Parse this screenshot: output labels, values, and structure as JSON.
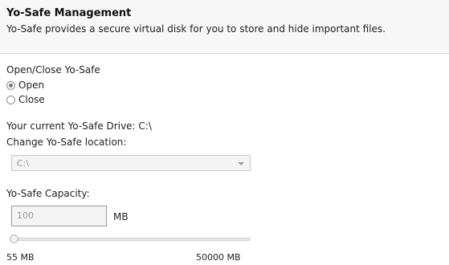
{
  "header": {
    "title": "Yo-Safe Management",
    "subtitle": "Yo-Safe provides a secure virtual disk for you to store and hide important files."
  },
  "toggle": {
    "label": "Open/Close Yo-Safe",
    "options": [
      "Open",
      "Close"
    ],
    "selected": "Open"
  },
  "drive": {
    "current_label": "Your current Yo-Safe Drive: C:\\",
    "change_label": "Change Yo-Safe location:",
    "selected_value": "C:\\"
  },
  "capacity": {
    "label": "Yo-Safe Capacity:",
    "value": "100",
    "unit": "MB",
    "min_label": "55 MB",
    "max_label": "50000 MB",
    "slider_fraction": 0.0
  },
  "colors": {
    "header_bg": "#f7f7f7",
    "disabled_text": "#9a9a9a"
  }
}
